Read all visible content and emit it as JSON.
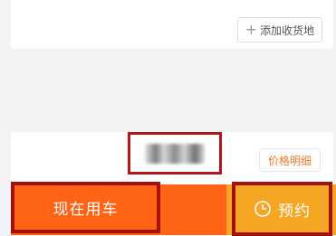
{
  "address": {
    "add_button_label": "添加收货地"
  },
  "pricing": {
    "price_detail_label": "价格明细"
  },
  "actions": {
    "use_now_label": "现在用车",
    "reserve_label": "预约"
  },
  "icons": {
    "add": "plus-icon",
    "reserve": "clock-icon"
  },
  "colors": {
    "use_now_bg": "#ff6315",
    "reserve_bg": "#f5a623",
    "highlight_frame": "#a51010",
    "price_detail_text": "#f07a2a"
  }
}
